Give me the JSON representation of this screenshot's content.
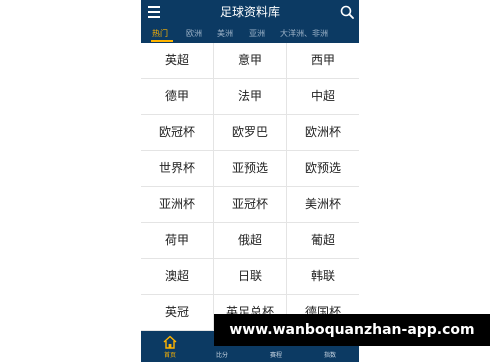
{
  "header": {
    "title": "足球资料库"
  },
  "tabs": [
    {
      "label": "热门",
      "active": true
    },
    {
      "label": "欧洲"
    },
    {
      "label": "美洲"
    },
    {
      "label": "亚洲"
    },
    {
      "label": "大洋洲、非洲"
    }
  ],
  "leagues": [
    [
      "英超",
      "意甲",
      "西甲"
    ],
    [
      "德甲",
      "法甲",
      "中超"
    ],
    [
      "欧冠杯",
      "欧罗巴",
      "欧洲杯"
    ],
    [
      "世界杯",
      "亚预选",
      "欧预选"
    ],
    [
      "亚洲杯",
      "亚冠杯",
      "美洲杯"
    ],
    [
      "荷甲",
      "俄超",
      "葡超"
    ],
    [
      "澳超",
      "日联",
      "韩联"
    ],
    [
      "英冠",
      "英足总杯",
      "德国杯"
    ]
  ],
  "bottom_nav": [
    {
      "label": "首页",
      "icon": "home-icon",
      "active": true
    },
    {
      "label": "比分"
    },
    {
      "label": "赛程"
    },
    {
      "label": "指数"
    }
  ],
  "watermark": "www.wanboquanzhan-app.com",
  "colors": {
    "header_bg": "#0c3a63",
    "active_tab": "#ffb400",
    "grid_line": "#e4e4e4"
  }
}
